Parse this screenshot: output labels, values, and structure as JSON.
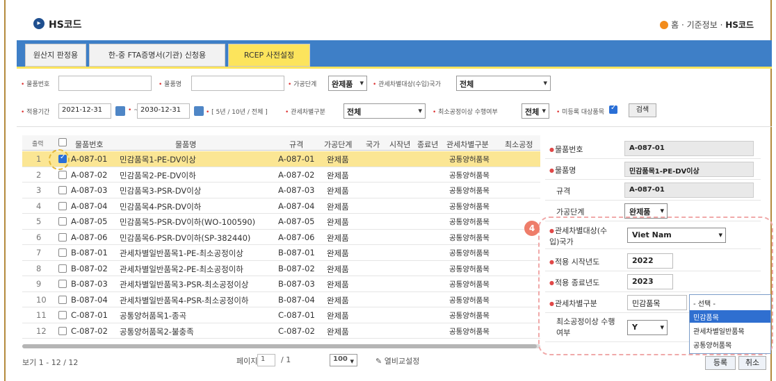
{
  "header": {
    "title": "HS코드",
    "breadcrumb": [
      "홈",
      "기준정보",
      "HS코드"
    ]
  },
  "tabs": [
    {
      "label": "원산지 판정용"
    },
    {
      "label": "한-중 FTA증명서(기관) 신청용"
    },
    {
      "label": "RCEP 사전설정"
    }
  ],
  "filters": {
    "item_no_label": "물품번호",
    "item_name_label": "물품명",
    "process_label": "가공단계",
    "process_value": "완제품",
    "tariff_target_label": "관세차별대상(수입)국가",
    "tariff_target_value": "전체",
    "period_label": "적용기간",
    "date_from": "2021-12-31",
    "date_sep": "~",
    "date_to": "2030-12-31",
    "period_opts": "[ 5년 / 10년 / 전체 ]",
    "tariff_type_label": "관세차별구분",
    "tariff_type_value": "전체",
    "min_process_label": "최소공정이상 수행여부",
    "min_process_value": "전체",
    "unset_label": "미등록 대상품목",
    "search_button": "검색"
  },
  "grid": {
    "headers": [
      "출력",
      "물품번호",
      "물품명",
      "규격",
      "가공단계",
      "국가",
      "시작년",
      "종료년",
      "관세차별구분",
      "최소공정"
    ],
    "rows": [
      {
        "n": "1",
        "checked": true,
        "no": "A-087-01",
        "name": "민감품목1-PE-DV이상",
        "spec": "A-087-01",
        "stage": "완제품",
        "type": "공통양허품목"
      },
      {
        "n": "2",
        "checked": false,
        "no": "A-087-02",
        "name": "민감품목2-PE-DV이하",
        "spec": "A-087-02",
        "stage": "완제품",
        "type": "공통양허품목"
      },
      {
        "n": "3",
        "checked": false,
        "no": "A-087-03",
        "name": "민감품목3-PSR-DV이상",
        "spec": "A-087-03",
        "stage": "완제품",
        "type": "공통양허품목"
      },
      {
        "n": "4",
        "checked": false,
        "no": "A-087-04",
        "name": "민감품목4-PSR-DV이하",
        "spec": "A-087-04",
        "stage": "완제품",
        "type": "공통양허품목"
      },
      {
        "n": "5",
        "checked": false,
        "no": "A-087-05",
        "name": "민감품목5-PSR-DV이하(WO-100590)",
        "spec": "A-087-05",
        "stage": "완제품",
        "type": "공통양허품목"
      },
      {
        "n": "6",
        "checked": false,
        "no": "A-087-06",
        "name": "민감품목6-PSR-DV이하(SP-382440)",
        "spec": "A-087-06",
        "stage": "완제품",
        "type": "공통양허품목"
      },
      {
        "n": "7",
        "checked": false,
        "no": "B-087-01",
        "name": "관세차별일반품목1-PE-최소공정이상",
        "spec": "B-087-01",
        "stage": "완제품",
        "type": "공통양허품목"
      },
      {
        "n": "8",
        "checked": false,
        "no": "B-087-02",
        "name": "관세차별일반품목2-PE-최소공정이하",
        "spec": "B-087-02",
        "stage": "완제품",
        "type": "공통양허품목"
      },
      {
        "n": "9",
        "checked": false,
        "no": "B-087-03",
        "name": "관세차별일반품목3-PSR-최소공정이상",
        "spec": "B-087-03",
        "stage": "완제품",
        "type": "공통양허품목"
      },
      {
        "n": "10",
        "checked": false,
        "no": "B-087-04",
        "name": "관세차별일반품목4-PSR-최소공정이하",
        "spec": "B-087-04",
        "stage": "완제품",
        "type": "공통양허품목"
      },
      {
        "n": "11",
        "checked": false,
        "no": "C-087-01",
        "name": "공통양허품목1-종곡",
        "spec": "C-087-01",
        "stage": "완제품",
        "type": "공통양허품목"
      },
      {
        "n": "12",
        "checked": false,
        "no": "C-087-02",
        "name": "공통양허품목2-불충족",
        "spec": "C-087-02",
        "stage": "완제품",
        "type": "공통양허품목"
      }
    ]
  },
  "pager": {
    "view_text": "보기 1 - 12 / 12",
    "page_label": "페이지",
    "page_value": "1",
    "page_total": "/ 1",
    "per_page": "100",
    "column_setting": "열비교설정"
  },
  "detail": {
    "item_no_label": "물품번호",
    "item_no_value": "A-087-01",
    "item_name_label": "물품명",
    "item_name_value": "민감품목1-PE-DV이상",
    "spec_label": "규격",
    "spec_value": "A-087-01",
    "stage_label": "가공단계",
    "stage_value": "완제품",
    "country_label": "관세차별대상(수입)국가",
    "country_value": "Viet Nam",
    "start_label": "적용 시작년도",
    "start_value": "2022",
    "end_label": "적용 종료년도",
    "end_value": "2023",
    "type_label": "관세차별구분",
    "type_value": "민감품목",
    "min_label": "최소공정이상 수행여부",
    "min_value": "Y",
    "badge": "4",
    "dropdown_options": [
      "- 선택 -",
      "민감품목",
      "관세차별일반품목",
      "공통양허품목"
    ],
    "save_button": "등록",
    "cancel_button": "취소"
  }
}
